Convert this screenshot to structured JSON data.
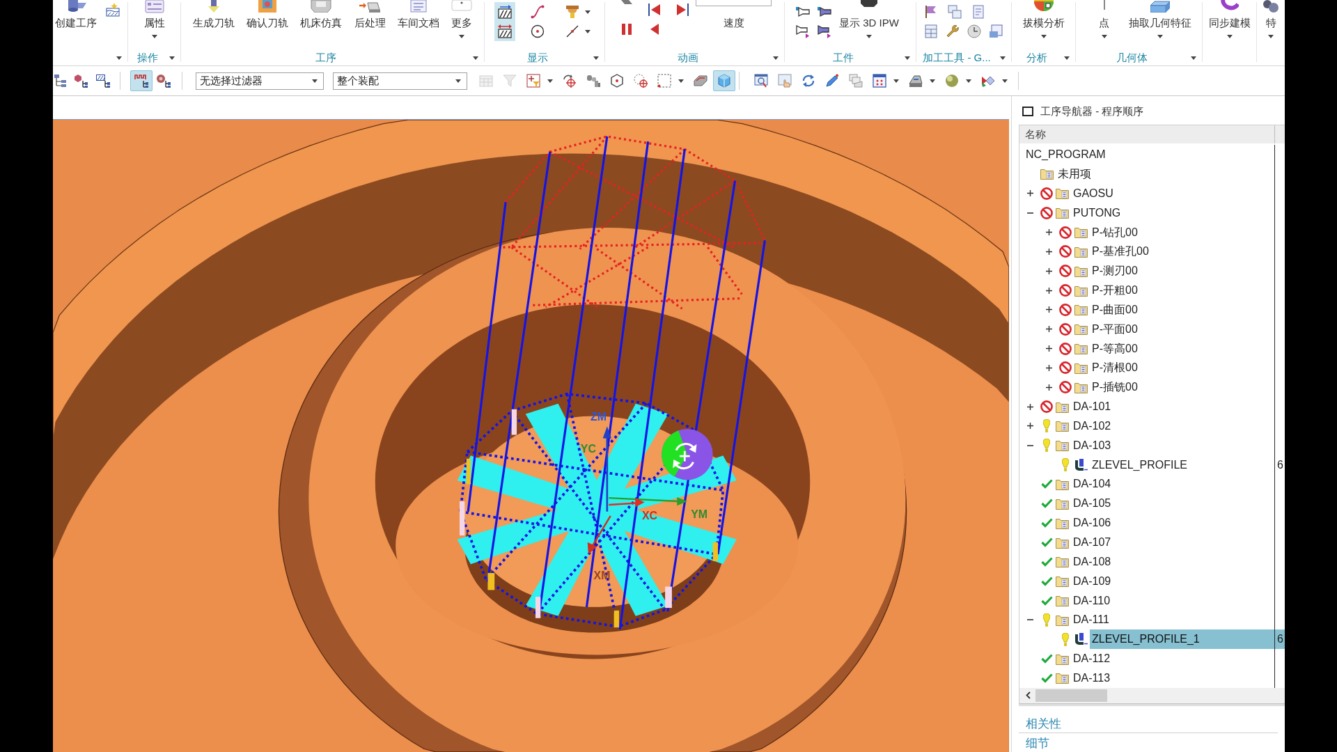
{
  "ribbon": {
    "groups": [
      {
        "launcher": true,
        "buttons": [
          {
            "label": "创建工序",
            "dropdown": false
          }
        ]
      },
      {
        "label": "操作",
        "launcher": true,
        "buttons": [
          {
            "label": "属性",
            "dropdown": true
          }
        ]
      },
      {
        "label": "工序",
        "launcher": true,
        "buttons": [
          {
            "label": "生成刀轨",
            "dropdown": false
          },
          {
            "label": "确认刀轨",
            "dropdown": false
          },
          {
            "label": "机床仿真",
            "dropdown": false
          },
          {
            "label": "后处理",
            "dropdown": false
          },
          {
            "label": "车间文档",
            "dropdown": false
          },
          {
            "label": "更多",
            "dropdown": true
          }
        ]
      },
      {
        "label": "显示",
        "launcher": true,
        "tools": [
          {
            "selected": true,
            "dropdown": false
          },
          {
            "selected": true,
            "dropdown": false
          },
          {
            "selected": false,
            "dropdown": false
          },
          {
            "selected": false,
            "dropdown": false
          },
          {
            "selected": false,
            "dropdown": true
          },
          {
            "selected": false,
            "dropdown": true
          }
        ]
      },
      {
        "label": "动画",
        "launcher": true,
        "speed": {
          "label": "速度"
        }
      },
      {
        "label": "工件",
        "launcher": true,
        "buttons": [
          {
            "label": "显示 3D IPW",
            "dropdown": true
          }
        ]
      },
      {
        "label": "加工工具 - G...",
        "launcher": true
      },
      {
        "label": "分析",
        "launcher": true,
        "buttons": [
          {
            "label": "拔模分析",
            "dropdown": true
          }
        ]
      },
      {
        "label": "几何体",
        "launcher": true,
        "buttons": [
          {
            "label": "点",
            "dropdown": true
          },
          {
            "label": "抽取几何特征",
            "dropdown": true
          }
        ]
      },
      {
        "launcher": false,
        "buttons": [
          {
            "label": "同步建模",
            "dropdown": true
          }
        ]
      },
      {
        "launcher": false,
        "buttons": [
          {
            "label": "特",
            "dropdown": true
          }
        ]
      }
    ]
  },
  "toolbar": {
    "tools_left": [
      {
        "selected": false,
        "disabled": false,
        "dropdown": false
      },
      {
        "selected": false,
        "disabled": false,
        "dropdown": false
      },
      {
        "selected": false,
        "disabled": false,
        "dropdown": false
      },
      {
        "selected": true,
        "disabled": false,
        "dropdown": false
      },
      {
        "selected": false,
        "disabled": false,
        "dropdown": false
      }
    ],
    "filters": [
      {
        "value": "无选择过滤器"
      },
      {
        "value": "整个装配"
      }
    ],
    "tools_middle": [
      {
        "selected": false,
        "disabled": true,
        "dropdown": false
      },
      {
        "selected": false,
        "disabled": true,
        "dropdown": false
      },
      {
        "selected": false,
        "disabled": false,
        "dropdown": true
      },
      {
        "selected": false,
        "disabled": false,
        "dropdown": false
      },
      {
        "selected": false,
        "disabled": false,
        "dropdown": false
      },
      {
        "selected": false,
        "disabled": false,
        "dropdown": false
      },
      {
        "selected": false,
        "disabled": false,
        "dropdown": false
      },
      {
        "selected": false,
        "disabled": false,
        "dropdown": true
      },
      {
        "selected": false,
        "disabled": false,
        "dropdown": false
      },
      {
        "selected": true,
        "disabled": false,
        "dropdown": false
      }
    ],
    "tools_right": [
      {
        "selected": false,
        "disabled": false,
        "dropdown": false
      },
      {
        "selected": false,
        "disabled": false,
        "dropdown": false
      },
      {
        "selected": false,
        "disabled": false,
        "dropdown": false
      },
      {
        "selected": false,
        "disabled": false,
        "dropdown": false
      },
      {
        "selected": false,
        "disabled": false,
        "dropdown": false
      },
      {
        "selected": false,
        "disabled": false,
        "dropdown": true
      },
      {
        "selected": false,
        "disabled": false,
        "dropdown": true
      },
      {
        "selected": false,
        "disabled": false,
        "dropdown": true
      },
      {
        "selected": false,
        "disabled": false,
        "dropdown": true
      }
    ]
  },
  "viewport": {
    "axis_labels": [
      "ZM",
      "YC",
      "XC",
      "YM",
      "XM"
    ]
  },
  "navigator": {
    "title": "工序导航器 - 程序顺序",
    "columns": [
      "名称"
    ],
    "tree": [
      {
        "name": "NC_PROGRAM",
        "selected": false,
        "children": [
          {
            "name": "未用项",
            "kind": "program",
            "selected": false
          },
          {
            "name": "GAOSU",
            "kind": "program",
            "status": {
              "kind": "forbidden"
            },
            "expanded": false,
            "selected": false
          },
          {
            "name": "PUTONG",
            "kind": "program",
            "status": {
              "kind": "forbidden"
            },
            "expanded": true,
            "selected": false,
            "children": [
              {
                "name": "P-钻孔00",
                "kind": "program",
                "status": {
                  "kind": "forbidden"
                },
                "expanded": false,
                "selected": false
              },
              {
                "name": "P-基准孔00",
                "kind": "program",
                "status": {
                  "kind": "forbidden"
                },
                "expanded": false,
                "selected": false
              },
              {
                "name": "P-测刃00",
                "kind": "program",
                "status": {
                  "kind": "forbidden"
                },
                "expanded": false,
                "selected": false
              },
              {
                "name": "P-开粗00",
                "kind": "program",
                "status": {
                  "kind": "forbidden"
                },
                "expanded": false,
                "selected": false
              },
              {
                "name": "P-曲面00",
                "kind": "program",
                "status": {
                  "kind": "forbidden"
                },
                "expanded": false,
                "selected": false
              },
              {
                "name": "P-平面00",
                "kind": "program",
                "status": {
                  "kind": "forbidden"
                },
                "expanded": false,
                "selected": false
              },
              {
                "name": "P-等高00",
                "kind": "program",
                "status": {
                  "kind": "forbidden"
                },
                "expanded": false,
                "selected": false
              },
              {
                "name": "P-清根00",
                "kind": "program",
                "status": {
                  "kind": "forbidden"
                },
                "expanded": false,
                "selected": false
              },
              {
                "name": "P-插铣00",
                "kind": "program",
                "status": {
                  "kind": "forbidden"
                },
                "expanded": false,
                "selected": false
              }
            ]
          },
          {
            "name": "DA-101",
            "kind": "program",
            "status": {
              "kind": "forbidden"
            },
            "expanded": false,
            "selected": false
          },
          {
            "name": "DA-102",
            "kind": "program",
            "status": {
              "kind": "warning"
            },
            "expanded": false,
            "selected": false
          },
          {
            "name": "DA-103",
            "kind": "program",
            "status": {
              "kind": "warning"
            },
            "expanded": true,
            "selected": false,
            "children": [
              {
                "name": "ZLEVEL_PROFILE",
                "kind": "operation",
                "status": {
                  "kind": "warning"
                },
                "selected": false,
                "column_2": "6"
              }
            ]
          },
          {
            "name": "DA-104",
            "kind": "program",
            "status": {
              "kind": "complete"
            },
            "selected": false
          },
          {
            "name": "DA-105",
            "kind": "program",
            "status": {
              "kind": "complete"
            },
            "selected": false
          },
          {
            "name": "DA-106",
            "kind": "program",
            "status": {
              "kind": "complete"
            },
            "selected": false
          },
          {
            "name": "DA-107",
            "kind": "program",
            "status": {
              "kind": "complete"
            },
            "selected": false
          },
          {
            "name": "DA-108",
            "kind": "program",
            "status": {
              "kind": "complete"
            },
            "selected": false
          },
          {
            "name": "DA-109",
            "kind": "program",
            "status": {
              "kind": "complete"
            },
            "selected": false
          },
          {
            "name": "DA-110",
            "kind": "program",
            "status": {
              "kind": "complete"
            },
            "selected": false
          },
          {
            "name": "DA-111",
            "kind": "program",
            "status": {
              "kind": "warning"
            },
            "expanded": true,
            "selected": false,
            "children": [
              {
                "name": "ZLEVEL_PROFILE_1",
                "kind": "operation",
                "status": {
                  "kind": "warning"
                },
                "selected": true,
                "column_2": "6"
              }
            ]
          },
          {
            "name": "DA-112",
            "kind": "program",
            "status": {
              "kind": "complete"
            },
            "selected": false
          },
          {
            "name": "DA-113",
            "kind": "program",
            "status": {
              "kind": "complete"
            },
            "selected": false
          }
        ]
      }
    ],
    "sections": [
      "相关性",
      "细节"
    ]
  }
}
